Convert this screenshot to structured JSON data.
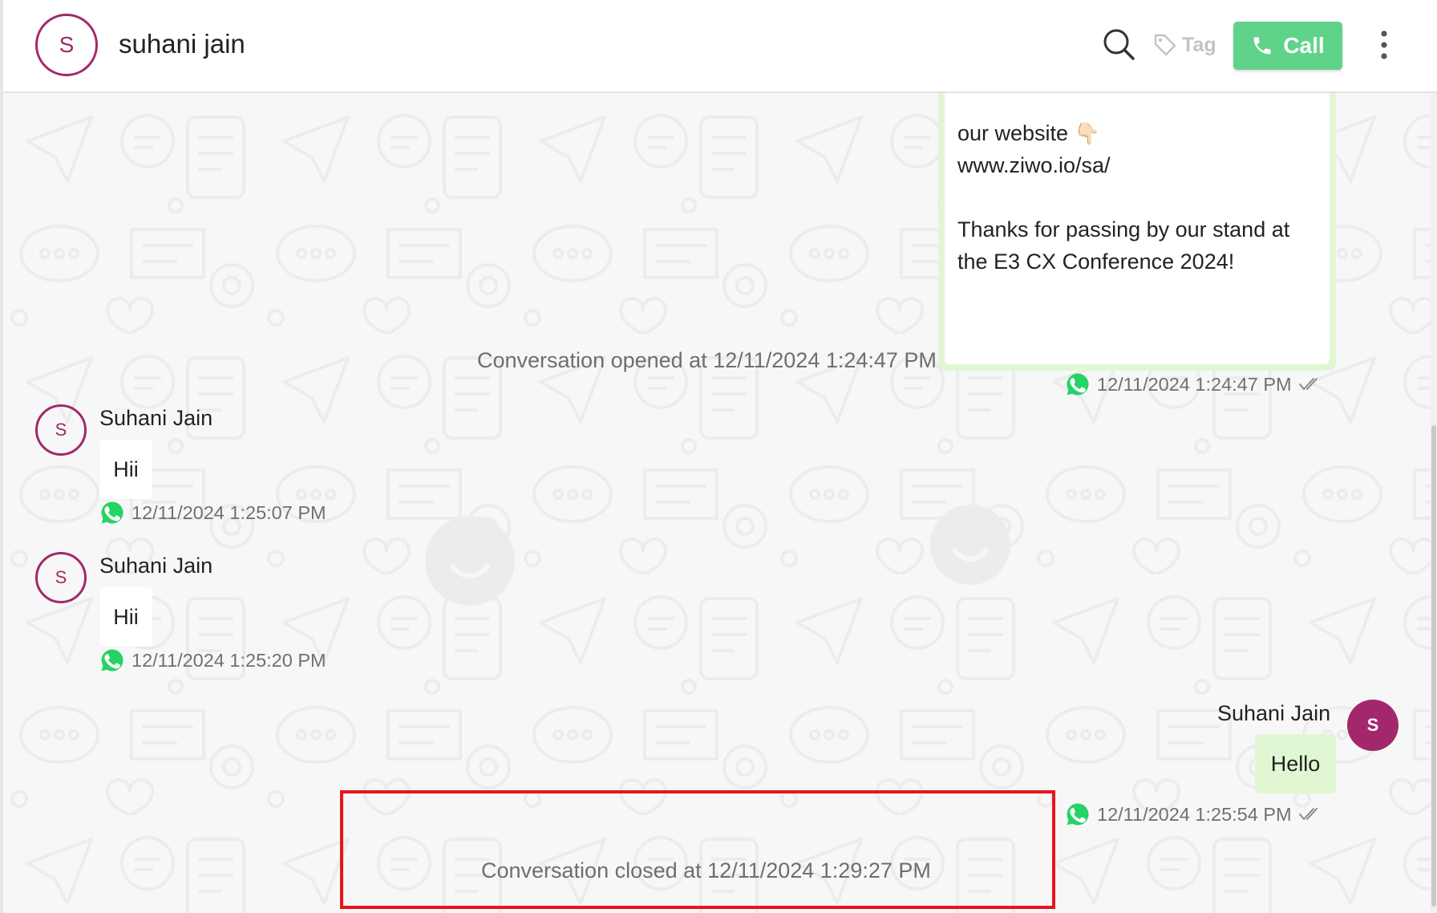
{
  "header": {
    "avatar_initial": "S",
    "contact_name": "suhani jain",
    "tag_label": "Tag",
    "call_label": "Call"
  },
  "colors": {
    "accent": "#a3286b",
    "call_button": "#5fd389",
    "outgoing_bubble": "#e1f7d4",
    "highlight_border": "#e8141c",
    "whatsapp": "#25d366"
  },
  "icons": [
    "search-icon",
    "tag-icon",
    "phone-icon",
    "kebab-menu-icon",
    "whatsapp-icon",
    "double-check-icon",
    "pointing-hand-emoji"
  ],
  "messages": {
    "first": {
      "line1": "our website",
      "emoji": "👇🏻",
      "line2": "www.ziwo.io/sa/",
      "line3": "Thanks for passing by our stand at",
      "line4": "the E3 CX Conference 2024!",
      "timestamp": "12/11/2024 1:24:47 PM"
    },
    "opened": "Conversation opened at 12/11/2024 1:24:47 PM",
    "in1": {
      "sender": "Suhani Jain",
      "avatar": "S",
      "text": "Hii",
      "timestamp": "12/11/2024 1:25:07 PM"
    },
    "in2": {
      "sender": "Suhani Jain",
      "avatar": "S",
      "text": "Hii",
      "timestamp": "12/11/2024 1:25:20 PM"
    },
    "out1": {
      "sender": "Suhani Jain",
      "avatar": "S",
      "text": "Hello",
      "timestamp": "12/11/2024 1:25:54 PM"
    },
    "closed": "Conversation closed at 12/11/2024 1:29:27 PM"
  }
}
